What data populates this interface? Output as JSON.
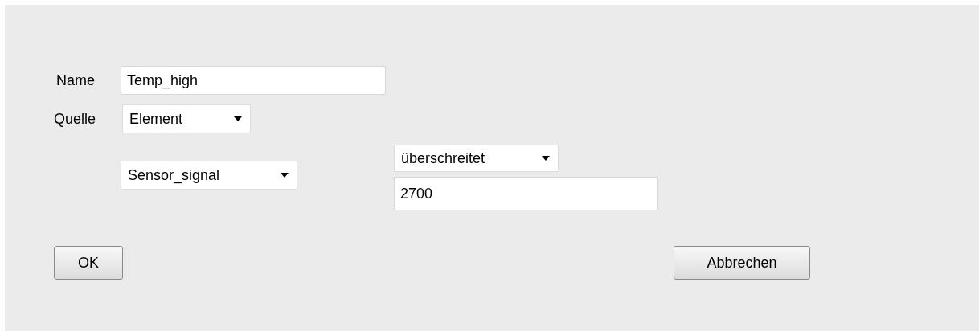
{
  "form": {
    "name_label": "Name",
    "name_value": "Temp_high",
    "source_label": "Quelle",
    "source_value": "Element",
    "element_value": "Sensor_signal",
    "condition_value": "überschreitet",
    "threshold_value": "2700"
  },
  "buttons": [
    "OK",
    "Abbrechen"
  ]
}
